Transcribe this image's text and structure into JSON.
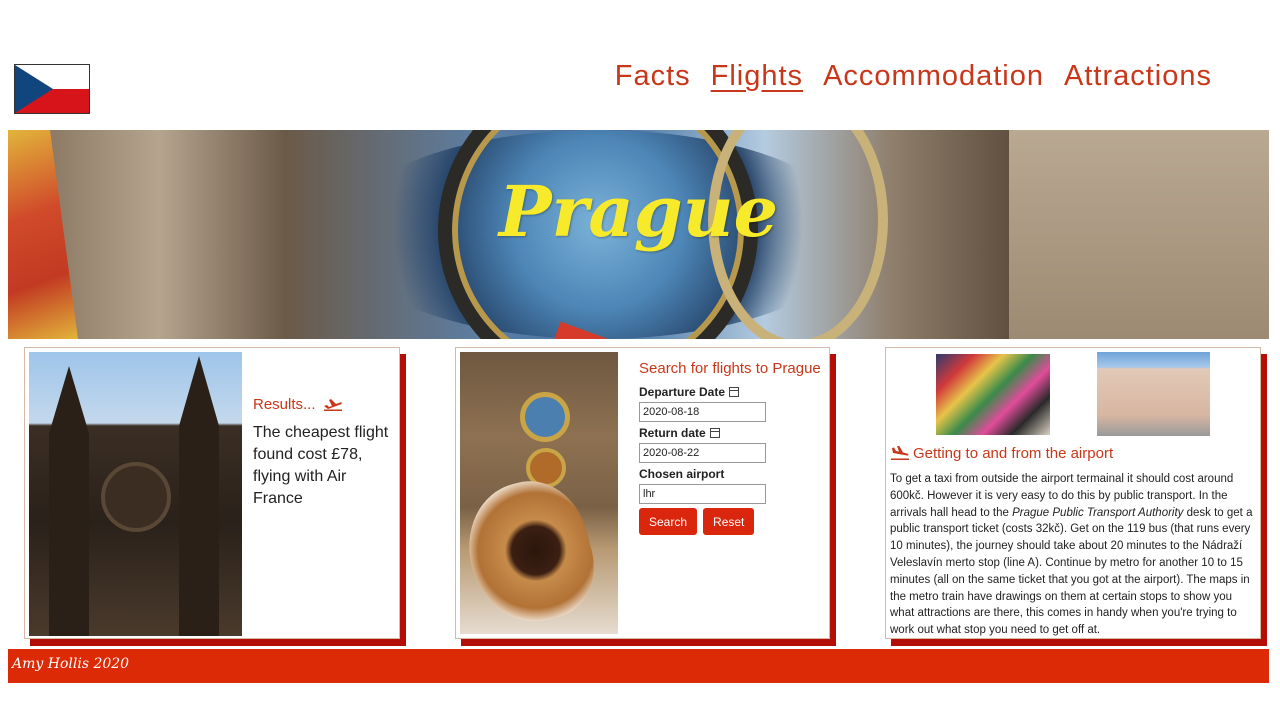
{
  "header": {
    "flag_icon": "czech-flag-icon",
    "nav": [
      {
        "label": "Facts",
        "active": false
      },
      {
        "label": "Flights",
        "active": true
      },
      {
        "label": "Accommodation",
        "active": false
      },
      {
        "label": "Attractions",
        "active": false
      }
    ]
  },
  "hero": {
    "title": "Prague"
  },
  "results": {
    "heading": "Results...",
    "icon": "plane-departure-icon",
    "text": "The cheapest flight found cost £78, flying with Air France"
  },
  "search": {
    "title": "Search for flights to Prague",
    "departure_label": "Departure Date",
    "departure_value": "2020-08-18",
    "return_label": "Return date",
    "return_value": "2020-08-22",
    "airport_label": "Chosen airport",
    "airport_value": "lhr",
    "search_button": "Search",
    "reset_button": "Reset",
    "calendar_icon": "calendar-icon"
  },
  "airport": {
    "heading": "Getting to and from the airport",
    "icon": "plane-landing-icon",
    "text_part1": "To get a taxi from outside the airport termainal it should cost around 600kč. However it is very easy to do this by public transport. In the arrivals hall head to the ",
    "text_italic": "Prague Public Transport Authority",
    "text_part2": " desk to get a public transport ticket (costs 32kč). Get on the 119 bus (that runs every 10 minutes), the journey should take about 20 minutes to the Nádraží Veleslavín merto stop (line A). Continue by metro for another 10 to 15 minutes (all on the same ticket that you got at the airport). The maps in the metro train have drawings on them at certain stops to show you what attractions are there, this comes in handy when you're trying to work out what stop you need to get off at."
  },
  "footer": {
    "text": "Amy Hollis 2020"
  },
  "colors": {
    "accent": "#c8371a",
    "footer_bg": "#dc2a06",
    "button_bg": "#d9260c",
    "hero_title": "#f7ea2a",
    "card_shadow": "#b40f07"
  }
}
